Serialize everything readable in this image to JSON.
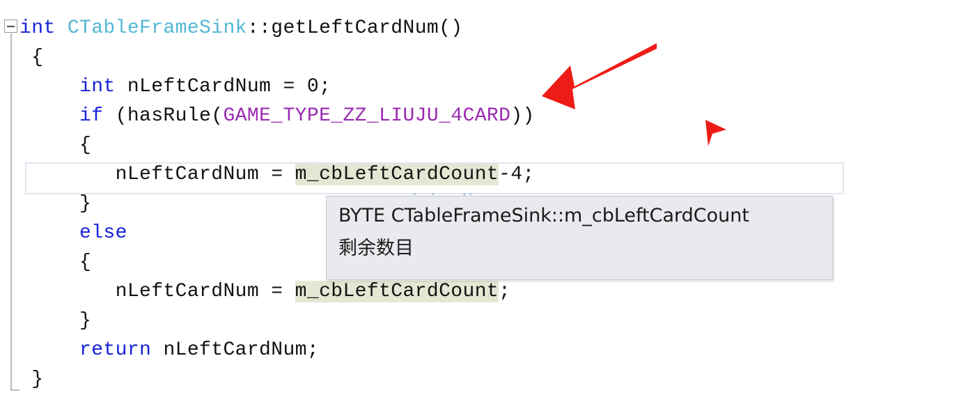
{
  "editor": {
    "language": "cpp",
    "outlining": {
      "collapse_glyph": "minus",
      "state": "expanded"
    },
    "colors": {
      "keyword": "#1622d8",
      "type_identifier": "#53b7d4",
      "macro": "#9b29b2",
      "plain_text": "#121212",
      "reference_highlight": "#e6e6d4",
      "current_line_border": "#e3e4f2",
      "tooltip_background": "#e9e9ee",
      "tooltip_border": "#c9c9d2",
      "annotation_red": "#ee1c16",
      "watermark": "#8fb4d9"
    },
    "lines": [
      {
        "id": "line-signature",
        "tokens": [
          {
            "text": "int ",
            "style": "kw"
          },
          {
            "text": "CTableFrameSink",
            "style": "type-id"
          },
          {
            "text": "::getLeftCardNum()",
            "style": "plain"
          }
        ]
      },
      {
        "id": "line-open-brace",
        "tokens": [
          {
            "text": " {",
            "style": "plain"
          }
        ]
      },
      {
        "id": "line-decl-nleftcardnum",
        "tokens": [
          {
            "text": "     int ",
            "style": "kw"
          },
          {
            "text": "nLeftCardNum = 0;",
            "style": "plain"
          }
        ]
      },
      {
        "id": "line-if-hasrule",
        "tokens": [
          {
            "text": "     if ",
            "style": "kw"
          },
          {
            "text": "(hasRule(",
            "style": "plain"
          },
          {
            "text": "GAME_TYPE_ZZ_LIUJU_4CARD",
            "style": "macro"
          },
          {
            "text": "))",
            "style": "plain"
          }
        ]
      },
      {
        "id": "line-if-open-brace",
        "tokens": [
          {
            "text": "     {",
            "style": "plain"
          }
        ]
      },
      {
        "id": "line-assign-minus4",
        "tokens": [
          {
            "text": "        nLeftCardNum = ",
            "style": "plain"
          },
          {
            "text": "m_cbLeftCardCount",
            "style": "hl-ident"
          },
          {
            "text": "-4;",
            "style": "plain"
          }
        ]
      },
      {
        "id": "line-if-close-brace",
        "tokens": [
          {
            "text": "     }",
            "style": "plain"
          }
        ]
      },
      {
        "id": "line-else",
        "tokens": [
          {
            "text": "     else",
            "style": "kw"
          }
        ]
      },
      {
        "id": "line-else-open-brace",
        "tokens": [
          {
            "text": "     {",
            "style": "plain"
          }
        ]
      },
      {
        "id": "line-assign-plain",
        "tokens": [
          {
            "text": "        nLeftCardNum = ",
            "style": "plain"
          },
          {
            "text": "m_cbLeftCardCount",
            "style": "hl-ident"
          },
          {
            "text": ";",
            "style": "plain"
          }
        ]
      },
      {
        "id": "line-else-close-brace",
        "tokens": [
          {
            "text": "     }",
            "style": "plain"
          }
        ]
      },
      {
        "id": "line-return",
        "tokens": [
          {
            "text": "     return ",
            "style": "kw"
          },
          {
            "text": "nLeftCardNum;",
            "style": "plain"
          }
        ]
      },
      {
        "id": "line-close-brace",
        "tokens": [
          {
            "text": " }",
            "style": "plain"
          }
        ]
      }
    ],
    "current_line_index": 5
  },
  "tooltip": {
    "signature": "BYTE CTableFrameSink::m_cbLeftCardCount",
    "description": "剩余数目"
  },
  "watermark": {
    "text": "wsixiaolive.com"
  },
  "annotations": {
    "arrow_label": "red-pointer-arrow",
    "cursor_label": "red-triangle-cursor"
  }
}
